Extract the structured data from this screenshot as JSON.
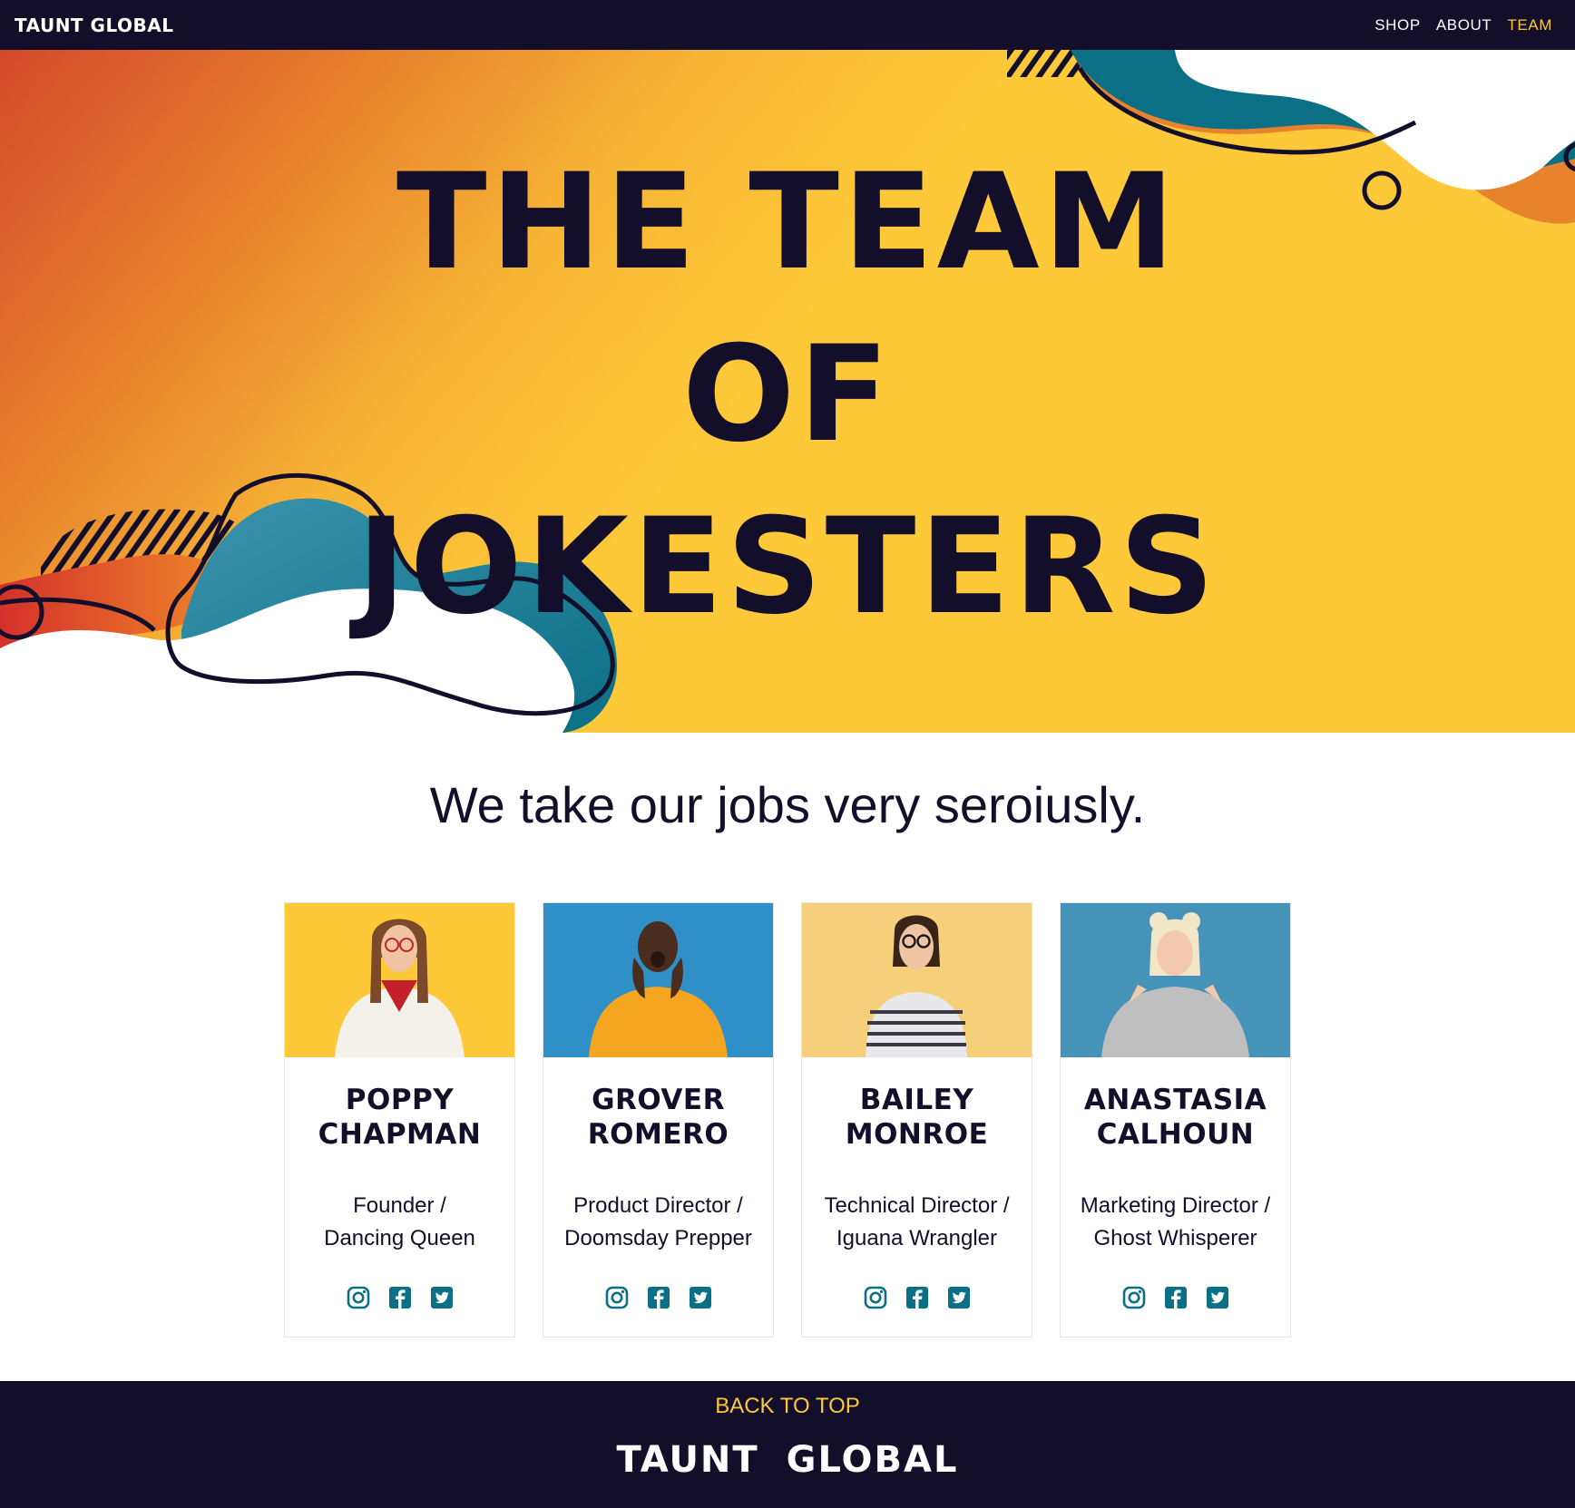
{
  "nav": {
    "logo": "TAUNT GLOBAL",
    "links": [
      {
        "label": "SHOP",
        "active": false
      },
      {
        "label": "ABOUT",
        "active": false
      },
      {
        "label": "TEAM",
        "active": true
      }
    ]
  },
  "hero": {
    "title_lines": [
      "THE TEAM",
      "OF",
      "JOKESTERS"
    ]
  },
  "tagline": "We take our jobs very seroiusly.",
  "team": [
    {
      "name_line1": "POPPY",
      "name_line2": "CHAPMAN",
      "role_line1": "Founder /",
      "role_line2": "Dancing Queen",
      "photo_bg": "#fdc938",
      "shirt": "#f4f1ea"
    },
    {
      "name_line1": "GROVER",
      "name_line2": "ROMERO",
      "role_line1": "Product Director /",
      "role_line2": "Doomsday Prepper",
      "photo_bg": "#2f8fc7",
      "shirt": "#f5a51f"
    },
    {
      "name_line1": "BAILEY",
      "name_line2": "MONROE",
      "role_line1": "Technical Director /",
      "role_line2": "Iguana Wrangler",
      "photo_bg": "#f6cf7a",
      "shirt": "#e8e8ec"
    },
    {
      "name_line1": "ANASTASIA",
      "name_line2": "CALHOUN",
      "role_line1": "Marketing Director /",
      "role_line2": "Ghost Whisperer",
      "photo_bg": "#4593b8",
      "shirt": "#bfbfbf"
    }
  ],
  "socials": [
    "instagram-icon",
    "facebook-icon",
    "twitter-icon"
  ],
  "footer": {
    "back_to_top": "BACK TO TOP",
    "logo": "TAUNT GLOBAL"
  },
  "colors": {
    "navy": "#130f2a",
    "yellow": "#fdc938",
    "teal": "#0b6f86",
    "orange": "#e7822d",
    "red": "#d4492b"
  }
}
